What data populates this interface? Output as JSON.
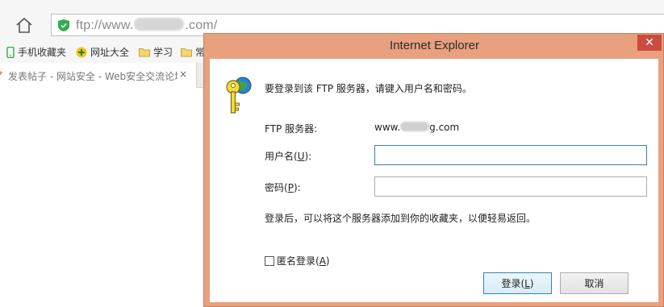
{
  "browser": {
    "address": {
      "prefix": "ftp://www.",
      "suffix": ".com/"
    },
    "bookmarks": [
      {
        "label": "手机收藏夹",
        "icon": "phone-icon"
      },
      {
        "label": "网址大全",
        "icon": "site-nav-icon"
      },
      {
        "label": "学习",
        "icon": "folder-icon"
      },
      {
        "label": "常",
        "icon": "folder-icon"
      }
    ],
    "tab": {
      "title": "发表帖子 - 网站安全 - Web安全交流论坛",
      "close": "×"
    }
  },
  "dialog": {
    "title": "Internet Explorer",
    "close_glyph": "✕",
    "prompt": "要登录到该 FTP 服务器，请键入用户名和密码。",
    "server_label": "FTP 服务器:",
    "server_prefix": "www.",
    "server_suffix": "g.com",
    "username_label_pre": "用户名(",
    "username_key": "U",
    "username_label_post": "):",
    "username_value": "",
    "password_label_pre": "密码(",
    "password_key": "P",
    "password_label_post": "):",
    "password_value": "",
    "note": "登录后，可以将这个服务器添加到你的收藏夹，以便轻易返回。",
    "anon_pre": "匿名登录(",
    "anon_key": "A",
    "anon_post": ")",
    "anon_checked": false,
    "login_pre": "登录(",
    "login_key": "L",
    "login_post": ")",
    "cancel": "取消"
  },
  "colors": {
    "dialog_frame": "#e8a07e",
    "close_button": "#c94c3f",
    "focus_border": "#3c7fb1"
  }
}
